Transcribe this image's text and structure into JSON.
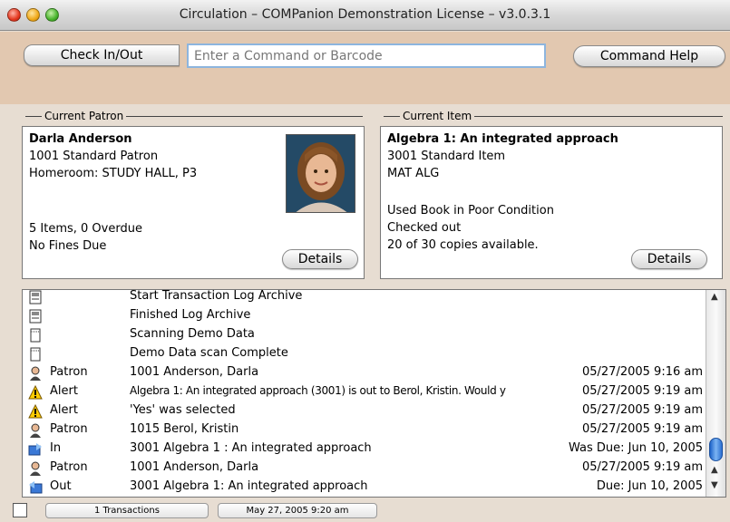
{
  "window": {
    "title": "Circulation – COMPanion Demonstration License – v3.0.3.1"
  },
  "toolbar": {
    "check_label": "Check In/Out",
    "command_placeholder": "Enter a Command or Barcode",
    "help_label": "Command Help"
  },
  "patron": {
    "header": "Current Patron",
    "name": "Darla Anderson",
    "id_line": "1001   Standard Patron",
    "homeroom": "Homeroom: STUDY HALL, P3",
    "items": "5 Items, 0 Overdue",
    "fines": "No Fines Due",
    "details_label": "Details"
  },
  "item": {
    "header": "Current Item",
    "title": "Algebra 1: An integrated approach",
    "id_line": "3001   Standard Item",
    "call": "MAT ALG",
    "condition": "Used Book in Poor Condition",
    "status": "Checked out",
    "availability": "20 of 30 copies available.",
    "details_label": "Details"
  },
  "log": {
    "rows": [
      {
        "icon": "archive-icon",
        "type": "",
        "detail": "Start Transaction Log Archive",
        "right": ""
      },
      {
        "icon": "archive-icon",
        "type": "",
        "detail": "Finished Log Archive",
        "right": ""
      },
      {
        "icon": "document-icon",
        "type": "",
        "detail": "Scanning Demo Data",
        "right": ""
      },
      {
        "icon": "document-icon",
        "type": "",
        "detail": "Demo Data scan Complete",
        "right": ""
      },
      {
        "icon": "patron-icon",
        "type": "Patron",
        "detail": "1001  Anderson, Darla",
        "right": "05/27/2005 9:16 am"
      },
      {
        "icon": "alert-icon",
        "type": "Alert",
        "detail": "Algebra 1: An integrated approach (3001) is out to Berol, Kristin. Would y",
        "right": "05/27/2005 9:19 am"
      },
      {
        "icon": "alert-icon",
        "type": "Alert",
        "detail": "'Yes' was selected",
        "right": "05/27/2005 9:19 am"
      },
      {
        "icon": "patron-icon",
        "type": "Patron",
        "detail": "1015  Berol, Kristin",
        "right": "05/27/2005 9:19 am"
      },
      {
        "icon": "book-in-icon",
        "type": "In",
        "detail": "3001 Algebra 1 : An integrated approach",
        "right": "Was Due: Jun 10, 2005"
      },
      {
        "icon": "patron-icon",
        "type": "Patron",
        "detail": "1001  Anderson, Darla",
        "right": "05/27/2005 9:19 am"
      },
      {
        "icon": "book-out-icon",
        "type": "Out",
        "detail": "3001 Algebra 1: An integrated approach",
        "right": "Due: Jun 10, 2005"
      }
    ]
  },
  "status": {
    "transactions": "1 Transactions",
    "date": "May 27, 2005  9:20 am"
  }
}
